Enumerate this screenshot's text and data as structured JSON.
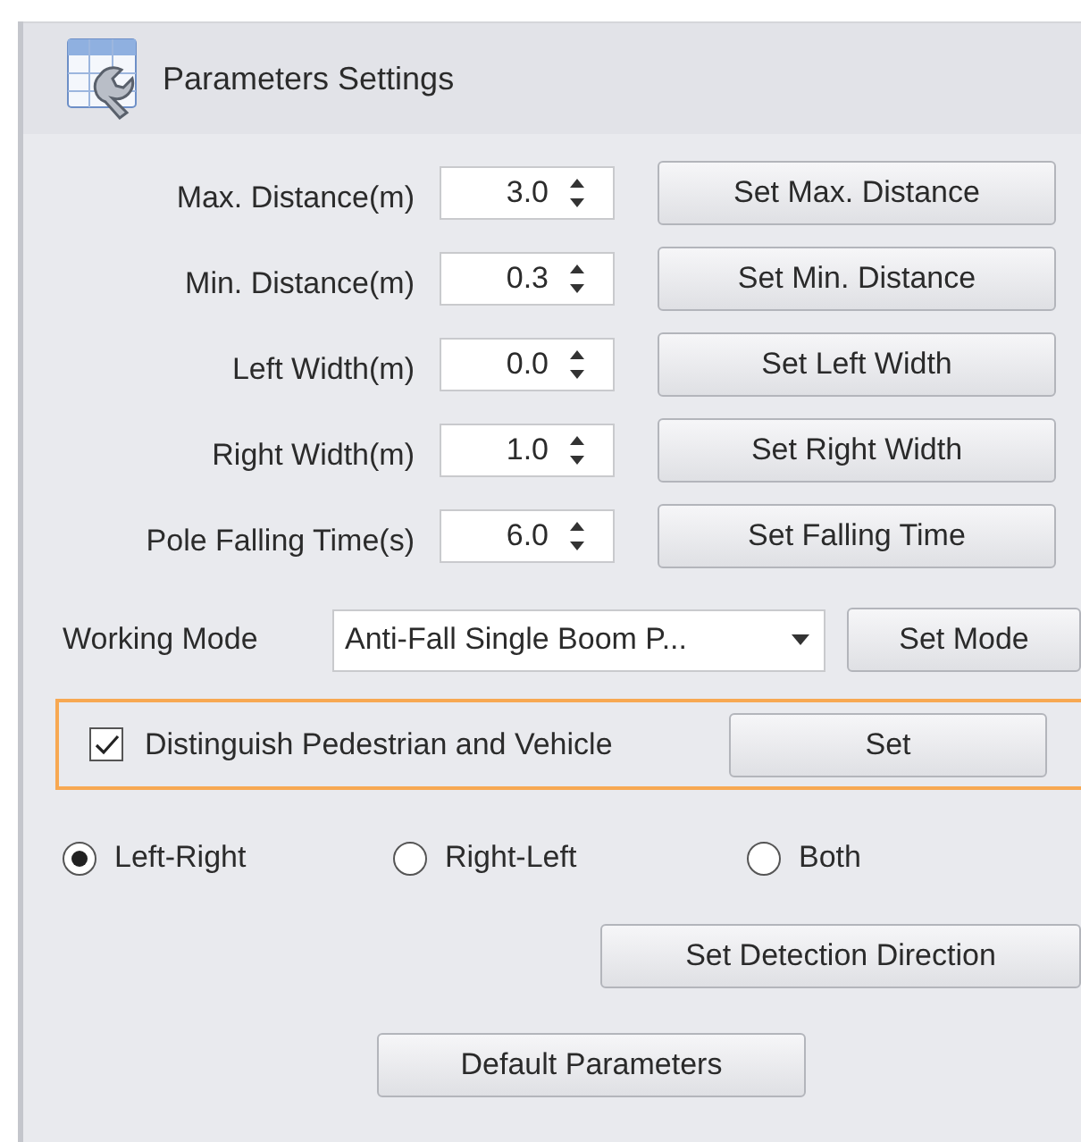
{
  "panel": {
    "title": "Parameters Settings"
  },
  "parameters": [
    {
      "label": "Max. Distance(m)",
      "value": "3.0",
      "button": "Set Max. Distance"
    },
    {
      "label": "Min. Distance(m)",
      "value": "0.3",
      "button": "Set Min. Distance"
    },
    {
      "label": "Left Width(m)",
      "value": "0.0",
      "button": "Set Left Width"
    },
    {
      "label": "Right Width(m)",
      "value": "1.0",
      "button": "Set Right Width"
    },
    {
      "label": "Pole Falling Time(s)",
      "value": "6.0",
      "button": "Set Falling Time"
    }
  ],
  "working_mode": {
    "label": "Working Mode",
    "value": "Anti-Fall Single Boom P...",
    "button": "Set Mode"
  },
  "distinguish": {
    "label": "Distinguish Pedestrian and Vehicle",
    "checked": true,
    "focused": true,
    "button": "Set"
  },
  "directions": [
    {
      "label": "Left-Right",
      "selected": true
    },
    {
      "label": "Right-Left",
      "selected": false
    },
    {
      "label": "Both",
      "selected": false
    }
  ],
  "direction_button": "Set Detection Direction",
  "default_button": "Default Parameters"
}
